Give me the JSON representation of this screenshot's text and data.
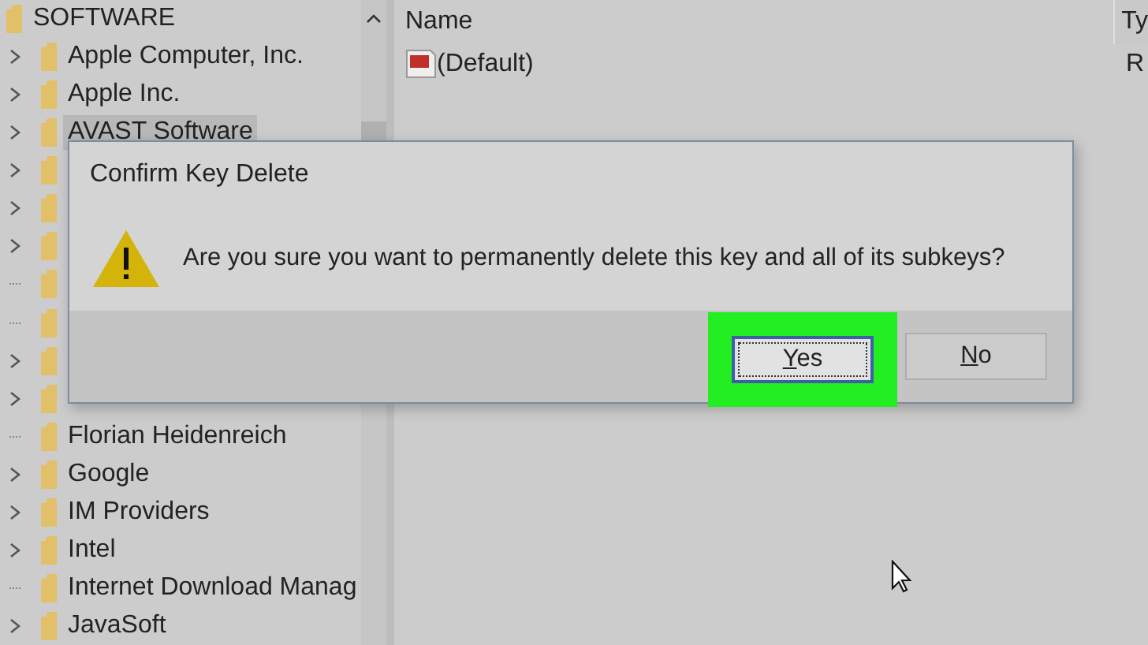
{
  "tree": {
    "root": {
      "name": "SOFTWARE",
      "expanded": true,
      "children": [
        {
          "name": "Apple Computer, Inc.",
          "expandable": true,
          "selected": false
        },
        {
          "name": "Apple Inc.",
          "expandable": true,
          "selected": false
        },
        {
          "name": "AVAST Software",
          "expandable": true,
          "selected": true
        },
        {
          "expandable": true,
          "selected": false
        },
        {
          "expandable": true,
          "selected": false
        },
        {
          "expandable": true,
          "selected": false
        },
        {
          "expandable": false,
          "selected": false
        },
        {
          "expandable": false,
          "selected": false
        },
        {
          "expandable": true,
          "selected": false
        },
        {
          "expandable": true,
          "selected": false
        },
        {
          "name": "Florian Heidenreich",
          "expandable": false,
          "selected": false
        },
        {
          "name": "Google",
          "expandable": true,
          "selected": false
        },
        {
          "name": "IM Providers",
          "expandable": true,
          "selected": false
        },
        {
          "name": "Intel",
          "expandable": true,
          "selected": false
        },
        {
          "name": "Internet Download Manag",
          "expandable": false,
          "selected": false
        },
        {
          "name": "JavaSoft",
          "expandable": true,
          "selected": false
        }
      ]
    }
  },
  "values": {
    "columns": [
      "Name",
      "Ty"
    ],
    "rows": [
      {
        "name": "(Default)",
        "type": "R"
      }
    ]
  },
  "dialog": {
    "title": "Confirm Key Delete",
    "message": "Are you sure you want to permanently delete this key and all of its subkeys?",
    "buttons": [
      {
        "label": "Yes",
        "focused": true,
        "highlighted": true
      },
      {
        "label": "No",
        "focused": false,
        "highlighted": false
      }
    ]
  }
}
